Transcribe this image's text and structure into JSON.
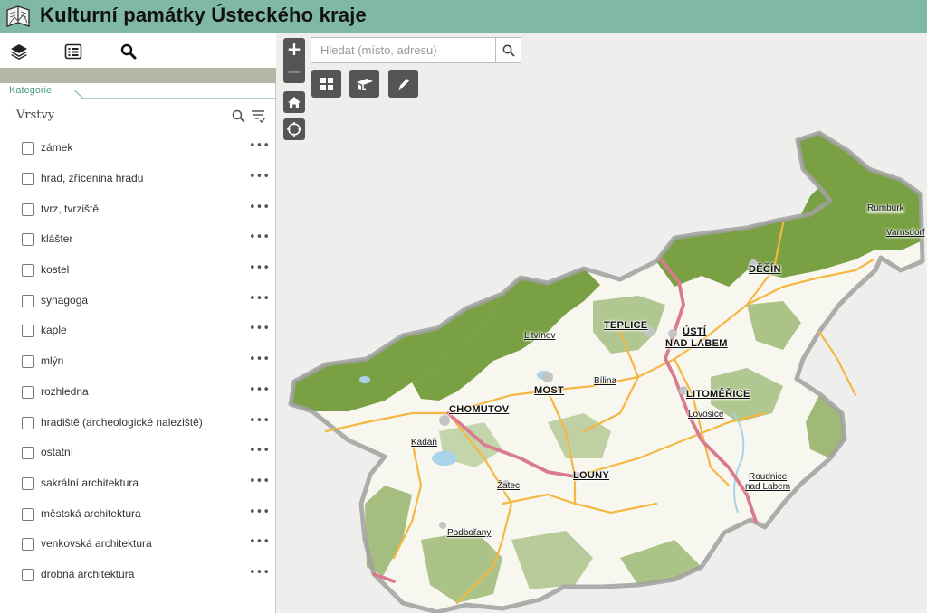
{
  "header": {
    "title": "Kulturní památky Ústeckého kraje",
    "logo_icon": "book-map-logo-icon",
    "background": "#7fb8a4"
  },
  "sidebar": {
    "tools": [
      {
        "name": "layers-icon"
      },
      {
        "name": "legend-list-icon"
      },
      {
        "name": "search-icon"
      }
    ],
    "tab_label": "Kategorie",
    "layers_heading": "Vrstvy",
    "layers": [
      {
        "label": "zámek"
      },
      {
        "label": "hrad, zřícenina hradu"
      },
      {
        "label": "tvrz, tvrziště"
      },
      {
        "label": "klášter"
      },
      {
        "label": "kostel"
      },
      {
        "label": "synagoga"
      },
      {
        "label": "kaple"
      },
      {
        "label": "mlýn"
      },
      {
        "label": "rozhledna"
      },
      {
        "label": "hradiště (archeologické naleziště)"
      },
      {
        "label": "ostatní"
      },
      {
        "label": "sakrální architektura"
      },
      {
        "label": "městská architektura"
      },
      {
        "label": "venkovská architektura"
      },
      {
        "label": "drobná architektura"
      }
    ],
    "more_label": "•••"
  },
  "map": {
    "zoom_in": "+",
    "zoom_out": "−",
    "search_placeholder": "Hledat (místo, adresu)",
    "widgets": [
      "basemap-gallery-icon",
      "measure-icon",
      "draw-pencil-icon"
    ],
    "controls": [
      "home-icon",
      "locate-icon"
    ],
    "colors": {
      "forest": "#79a043",
      "region": "#f7f7f0",
      "border": "#a0a0a0",
      "highway": "#d97b8c",
      "road": "#f4b742",
      "water": "#a9d3e8"
    },
    "places": [
      {
        "label": "Rumburk"
      },
      {
        "label": "Varnsdorf"
      },
      {
        "label": "DĚČÍN"
      },
      {
        "label": "TEPLICE"
      },
      {
        "label": "ÚSTÍ"
      },
      {
        "label": "NAD LABEM"
      },
      {
        "label": "Litvínov"
      },
      {
        "label": "Bílina"
      },
      {
        "label": "MOST"
      },
      {
        "label": "LITOMĚŘICE"
      },
      {
        "label": "Lovosice"
      },
      {
        "label": "CHOMUTOV"
      },
      {
        "label": "Kadaň"
      },
      {
        "label": "LOUNY"
      },
      {
        "label": "Žatec"
      },
      {
        "label": "Roudnice"
      },
      {
        "label": "nad Labem"
      },
      {
        "label": "Podbořany"
      }
    ]
  }
}
